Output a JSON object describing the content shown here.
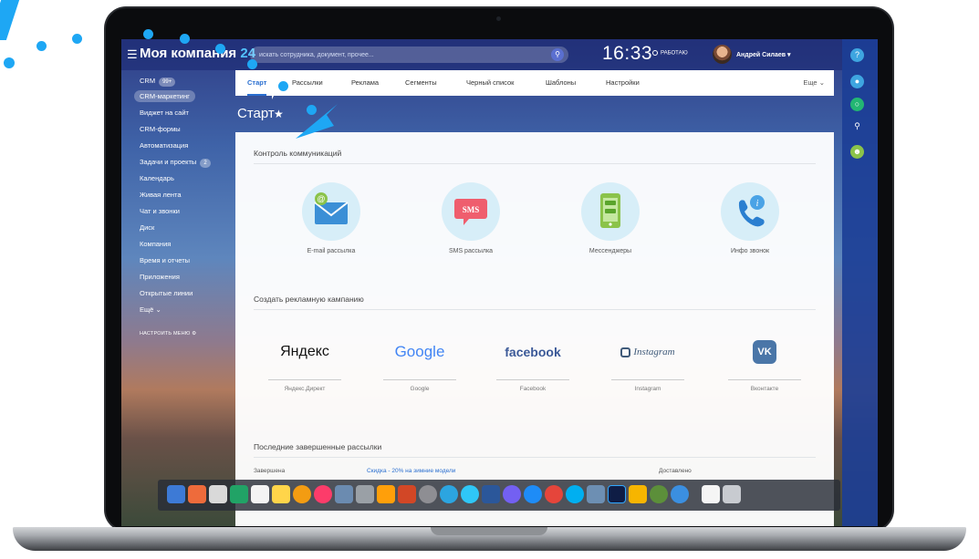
{
  "header": {
    "company_name": "Моя компания",
    "company_suffix": "24",
    "search_placeholder": "искать сотрудника, документ, прочее...",
    "clock": "16:33",
    "status": "РАБОТАЮ",
    "user_name": "Андрей Силаев"
  },
  "sidebar": {
    "items": [
      {
        "label": "CRM",
        "badge": "99+"
      },
      {
        "label": "CRM-маркетинг"
      },
      {
        "label": "Виджет на сайт"
      },
      {
        "label": "CRM-формы"
      },
      {
        "label": "Автоматизация"
      },
      {
        "label": "Задачи и проекты",
        "badge": "2"
      },
      {
        "label": "Календарь"
      },
      {
        "label": "Живая лента"
      },
      {
        "label": "Чат и звонки"
      },
      {
        "label": "Диск"
      },
      {
        "label": "Компания"
      },
      {
        "label": "Время и отчеты"
      },
      {
        "label": "Приложения"
      },
      {
        "label": "Открытые линии"
      },
      {
        "label": "Ещё"
      }
    ],
    "configure_label": "НАСТРОИТЬ МЕНЮ"
  },
  "tabs": {
    "items": [
      "Старт",
      "Рассылки",
      "Реклама",
      "Сегменты",
      "Черный список",
      "Шаблоны",
      "Настройки"
    ],
    "more": "Еще"
  },
  "page": {
    "title": "Старт",
    "sections": {
      "communications": "Контроль коммуникаций",
      "ad_campaign": "Создать рекламную кампанию",
      "last_mailings": "Последние завершенные рассылки"
    }
  },
  "communications": [
    {
      "label": "E-mail рассылка",
      "icon": "email-icon"
    },
    {
      "label": "SMS рассылка",
      "icon": "sms-icon",
      "text": "SMS"
    },
    {
      "label": "Мессенджеры",
      "icon": "messenger-icon"
    },
    {
      "label": "Инфо звонок",
      "icon": "phone-info-icon"
    }
  ],
  "ads": [
    {
      "logo": "Яндекс",
      "label": "Яндекс.Директ"
    },
    {
      "logo": "Google",
      "label": "Google"
    },
    {
      "logo": "facebook",
      "label": "Facebook"
    },
    {
      "logo": "Instagram",
      "label": "Instagram"
    },
    {
      "logo": "VK",
      "label": "Вконтакте"
    }
  ],
  "last_mailing": {
    "status": "Завершена",
    "name": "Скидка - 20% на зимние модели",
    "delivered": "Доставлено"
  },
  "colors": {
    "accent": "#2a6fd0",
    "deco": "#1ea7f4",
    "google_blue": "#4285f4",
    "facebook": "#3b5998",
    "vk": "#4a76a8"
  }
}
